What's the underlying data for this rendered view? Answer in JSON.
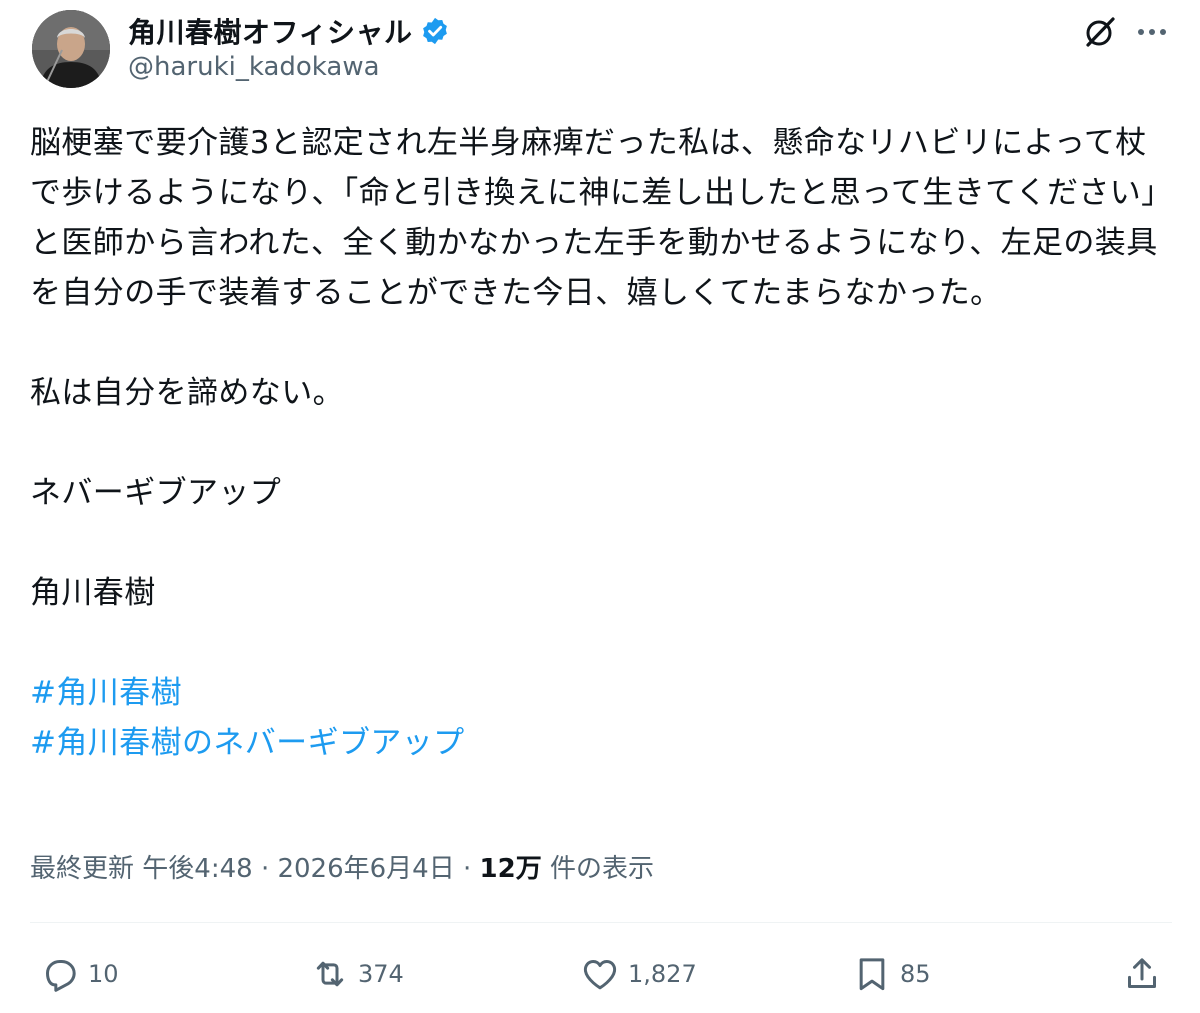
{
  "author": {
    "display_name": "角川春樹オフィシャル",
    "handle": "@haruki_kadokawa",
    "verified_icon": "verified-badge-icon",
    "badge_color": "#1d9bf0"
  },
  "header": {
    "grok_icon": "grok-icon",
    "more_icon": "more-dots-icon"
  },
  "post": {
    "paragraph1": "脳梗塞で要介護3と認定され左半身麻痺だった私は、懸命なリハビリによって杖で歩けるようになり、「命と引き換えに神に差し出したと思って生きてください」と医師から言われた、全く動かなかった左手を動かせるようになり、左足の装具を自分の手で装着することができた今日、嬉しくてたまらなかった。",
    "paragraph2": "私は自分を諦めない。",
    "paragraph3": "ネバーギブアップ",
    "paragraph4": "角川春樹",
    "hashtags": [
      "#角川春樹",
      "#角川春樹のネバーギブアップ"
    ],
    "hashtag_color": "#1d9bf0"
  },
  "meta": {
    "updated_label": "最終更新",
    "time": "午後4:48",
    "separator": "·",
    "date": "2026年6月4日",
    "views_count": "12万",
    "views_label": "件の表示"
  },
  "actions": {
    "reply": {
      "icon": "reply-icon",
      "count": "10"
    },
    "repost": {
      "icon": "repost-icon",
      "count": "374"
    },
    "like": {
      "icon": "heart-icon",
      "count": "1,827"
    },
    "bookmark": {
      "icon": "bookmark-icon",
      "count": "85"
    },
    "share": {
      "icon": "share-icon"
    }
  }
}
